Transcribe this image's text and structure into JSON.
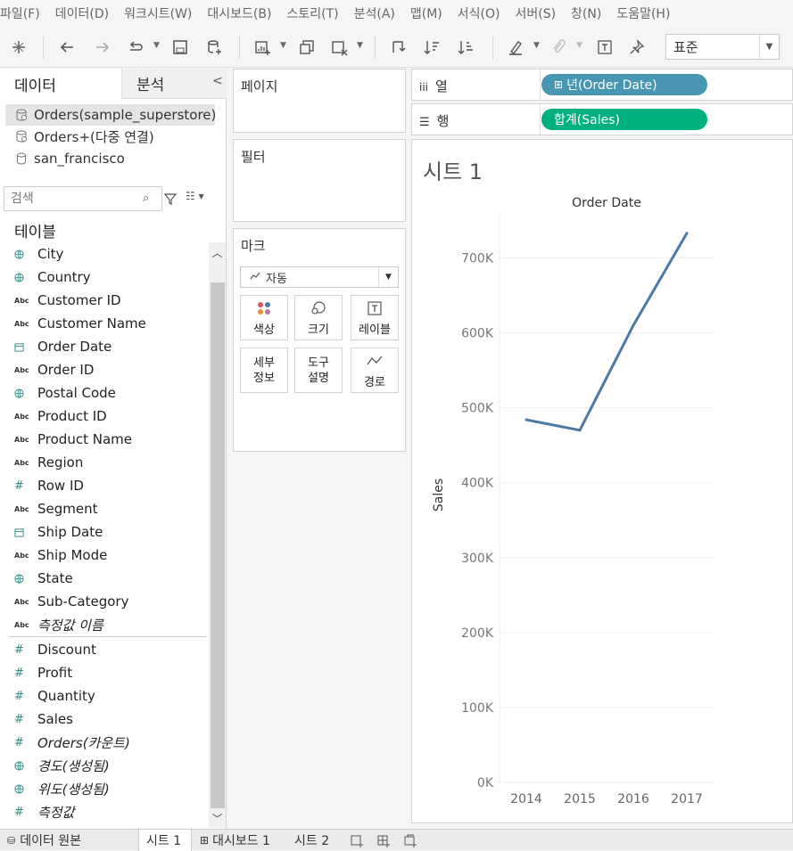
{
  "menu": [
    "파일(F)",
    "데이터(D)",
    "워크시트(W)",
    "대시보드(B)",
    "스토리(T)",
    "분석(A)",
    "맵(M)",
    "서식(O)",
    "서버(S)",
    "창(N)",
    "도움말(H)"
  ],
  "toolbar": {
    "fit_value": "표준"
  },
  "datapane": {
    "tab_data": "데이터",
    "tab_analysis": "분석",
    "datasources": [
      "Orders(sample_superstore)",
      "Orders+(다중 연결)",
      "san_francisco"
    ],
    "search_placeholder": "검색",
    "tables_heading": "테이블",
    "dimensions": [
      {
        "name": "City",
        "type": "geo"
      },
      {
        "name": "Country",
        "type": "geo"
      },
      {
        "name": "Customer ID",
        "type": "abc"
      },
      {
        "name": "Customer Name",
        "type": "abc"
      },
      {
        "name": "Order Date",
        "type": "date"
      },
      {
        "name": "Order ID",
        "type": "abc"
      },
      {
        "name": "Postal Code",
        "type": "geo"
      },
      {
        "name": "Product ID",
        "type": "abc"
      },
      {
        "name": "Product Name",
        "type": "abc"
      },
      {
        "name": "Region",
        "type": "abc"
      },
      {
        "name": "Row ID",
        "type": "num"
      },
      {
        "name": "Segment",
        "type": "abc"
      },
      {
        "name": "Ship Date",
        "type": "date"
      },
      {
        "name": "Ship Mode",
        "type": "abc"
      },
      {
        "name": "State",
        "type": "geo"
      },
      {
        "name": "Sub-Category",
        "type": "abc"
      },
      {
        "name": "측정값 이름",
        "type": "abc",
        "italic": true
      }
    ],
    "measures": [
      {
        "name": "Discount",
        "type": "num"
      },
      {
        "name": "Profit",
        "type": "num"
      },
      {
        "name": "Quantity",
        "type": "num"
      },
      {
        "name": "Sales",
        "type": "num"
      },
      {
        "name": "Orders(카운트)",
        "type": "num",
        "italic": true
      },
      {
        "name": "경도(생성됨)",
        "type": "geo",
        "italic": true
      },
      {
        "name": "위도(생성됨)",
        "type": "geo",
        "italic": true
      },
      {
        "name": "측정값",
        "type": "num",
        "italic": true
      }
    ]
  },
  "cards": {
    "pages": "페이지",
    "filters": "필터",
    "marks": "마크",
    "mark_type": "자동",
    "mark_buttons": {
      "color": "색상",
      "size": "크기",
      "label": "레이블",
      "detail": [
        "세부",
        "정보"
      ],
      "tooltip": [
        "도구",
        "설명"
      ],
      "path": "경로"
    }
  },
  "shelves": {
    "columns_label": "열",
    "rows_label": "행",
    "columns_pill": "년(Order Date)",
    "rows_pill": "합계(Sales)"
  },
  "sheet": {
    "title": "시트 1"
  },
  "chart_data": {
    "type": "line",
    "title": "Order Date",
    "xlabel": "Order Date",
    "ylabel": "Sales",
    "categories": [
      "2014",
      "2015",
      "2016",
      "2017"
    ],
    "series": [
      {
        "values": [
          484000,
          470000,
          610000,
          733000
        ]
      }
    ],
    "ylim": [
      0,
      760000
    ],
    "yticks": [
      0,
      100000,
      200000,
      300000,
      400000,
      500000,
      600000,
      700000
    ],
    "ytick_labels": [
      "0K",
      "100K",
      "200K",
      "300K",
      "400K",
      "500K",
      "600K",
      "700K"
    ],
    "grid": true,
    "color": "#4e79a7"
  },
  "bottom_tabs": [
    "데이터 원본",
    "시트 1",
    "대시보드 1",
    "시트 2"
  ]
}
